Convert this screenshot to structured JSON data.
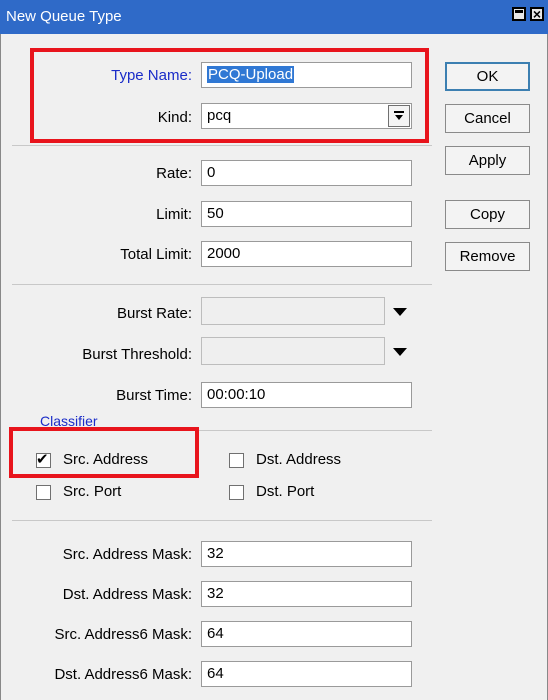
{
  "window": {
    "title": "New Queue Type",
    "maximize_icon": "maximize-icon",
    "close_icon": "close-icon",
    "close_glyph": "×"
  },
  "form": {
    "type_name_label": "Type Name:",
    "type_name_value": "PCQ-Upload",
    "kind_label": "Kind:",
    "kind_value": "pcq",
    "rate_label": "Rate:",
    "rate_value": "0",
    "limit_label": "Limit:",
    "limit_value": "50",
    "total_limit_label": "Total Limit:",
    "total_limit_value": "2000",
    "burst_rate_label": "Burst Rate:",
    "burst_rate_value": "",
    "burst_threshold_label": "Burst Threshold:",
    "burst_threshold_value": "",
    "burst_time_label": "Burst Time:",
    "burst_time_value": "00:00:10",
    "classifier_label": "Classifier",
    "src_address_label": "Src. Address",
    "src_address_checked": true,
    "dst_address_label": "Dst. Address",
    "dst_address_checked": false,
    "src_port_label": "Src. Port",
    "src_port_checked": false,
    "dst_port_label": "Dst. Port",
    "dst_port_checked": false,
    "src_mask_label": "Src. Address Mask:",
    "src_mask_value": "32",
    "dst_mask_label": "Dst. Address Mask:",
    "dst_mask_value": "32",
    "src6_mask_label": "Src. Address6 Mask:",
    "src6_mask_value": "64",
    "dst6_mask_label": "Dst. Address6 Mask:",
    "dst6_mask_value": "64",
    "checkmark_glyph": "✔"
  },
  "buttons": {
    "ok": "OK",
    "cancel": "Cancel",
    "apply": "Apply",
    "copy": "Copy",
    "remove": "Remove"
  },
  "colors": {
    "titlebar": "#2f6ac8",
    "label_blue": "#1a2cc8",
    "highlight_red": "#e8141c",
    "selection": "#3078d4"
  }
}
